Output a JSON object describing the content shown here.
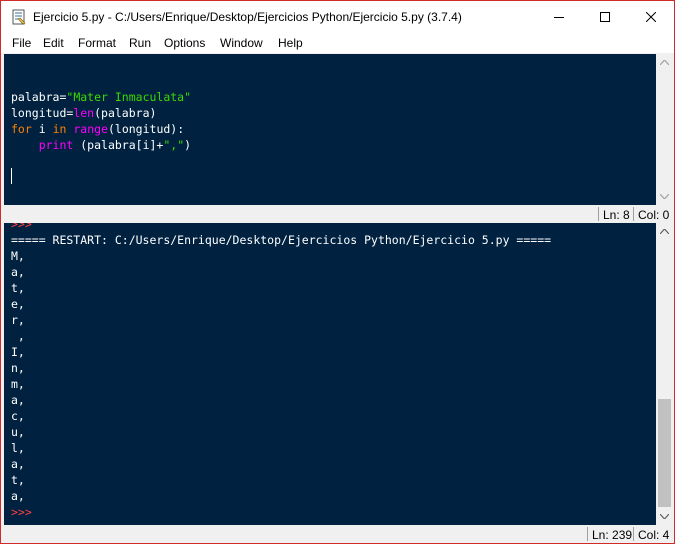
{
  "window": {
    "title": "Ejercicio 5.py - C:/Users/Enrique/Desktop/Ejercicios Python/Ejercicio 5.py (3.7.4)"
  },
  "menu": [
    "File",
    "Edit",
    "Format",
    "Run",
    "Options",
    "Window",
    "Help"
  ],
  "editor": {
    "line1_var": "palabra",
    "line1_eq": "=",
    "line1_str": "\"Mater Inmaculata\"",
    "line2_var": "longitud",
    "line2_eq": "=",
    "line2_fn": "len",
    "line2_rest": "(palabra)",
    "line3_for": "for",
    "line3_i": " i ",
    "line3_in": "in",
    "line3_sp": " ",
    "line3_range": "range",
    "line3_rest": "(longitud):",
    "line4_indent": "    ",
    "line4_print": "print",
    "line4_mid": " (palabra[i]+",
    "line4_str": "\",\"",
    "line4_close": ")",
    "status_ln": "Ln: 8",
    "status_col": "Col: 0"
  },
  "shell": {
    "prompt_top": ">>>",
    "restart_line": "===== RESTART: C:/Users/Enrique/Desktop/Ejercicios Python/Ejercicio 5.py =====",
    "output_lines": [
      "M,",
      "a,",
      "t,",
      "e,",
      "r,",
      " ,",
      "I,",
      "n,",
      "m,",
      "a,",
      "c,",
      "u,",
      "l,",
      "a,",
      "t,",
      "a,"
    ],
    "prompt_bottom": ">>>",
    "status_ln": "Ln: 239",
    "status_col": "Col: 4"
  },
  "colors": {
    "background": "#002240",
    "string": "#3ad900",
    "builtin": "#ff00ff",
    "keyword": "#ff8000",
    "prompt": "#ff4040"
  }
}
